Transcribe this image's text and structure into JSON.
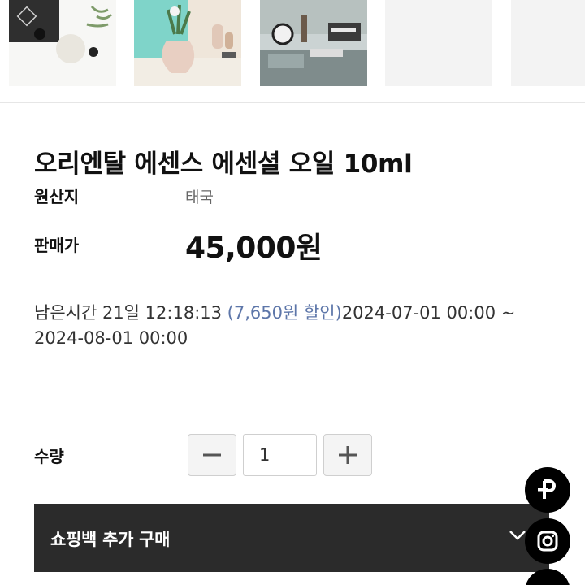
{
  "product": {
    "title": "오리엔탈 에센스 에센셜 오일 10ml",
    "origin_label": "원산지",
    "origin_value": "태국",
    "price_label": "판매가",
    "price": "45,000원"
  },
  "sale": {
    "remaining": "남은시간 21일 12:18:13 ",
    "discount": "(7,650원 할인)",
    "period": "2024-07-01 00:00 ~ 2024-08-01 00:00"
  },
  "quantity": {
    "label": "수량",
    "value": "1"
  },
  "addon": {
    "label": "쇼핑백 추가 구매"
  },
  "thumbnails": [
    {
      "icon": "product-photo-dark-box"
    },
    {
      "icon": "product-photo-vase"
    },
    {
      "icon": "product-photo-clock-desk"
    },
    {
      "icon": "empty"
    },
    {
      "icon": "empty"
    }
  ],
  "floating": [
    "p-logo-icon",
    "instagram-icon"
  ],
  "colors": {
    "accent_discount": "#5d76a9",
    "addon_bar": "#2b2b2b",
    "fab": "#000000"
  }
}
